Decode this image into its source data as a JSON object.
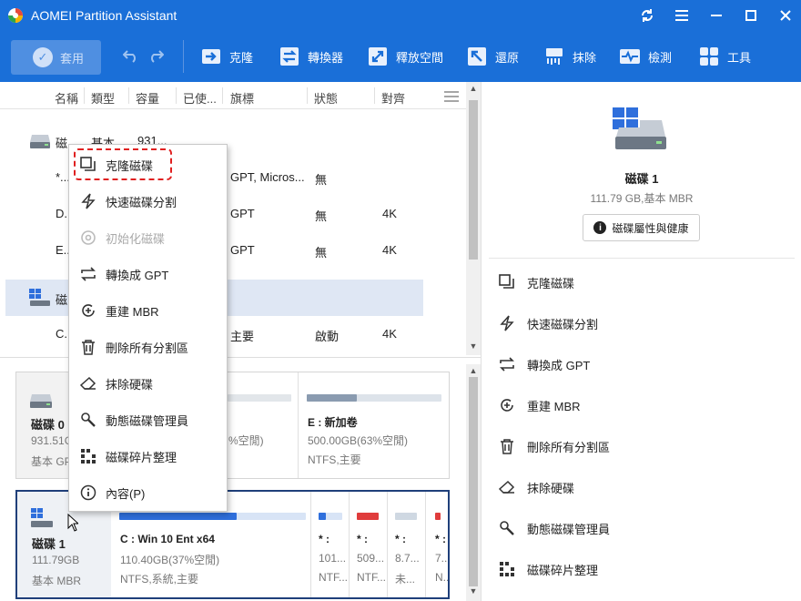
{
  "app": {
    "title": "AOMEI Partition Assistant"
  },
  "toolbar": {
    "apply_label": "套用",
    "buttons": [
      {
        "label": "克隆",
        "icon": "clone-icon"
      },
      {
        "label": "轉換器",
        "icon": "converter-icon"
      },
      {
        "label": "釋放空間",
        "icon": "free-space-icon"
      },
      {
        "label": "還原",
        "icon": "restore-icon"
      },
      {
        "label": "抹除",
        "icon": "wipe-icon"
      },
      {
        "label": "檢測",
        "icon": "check-icon"
      },
      {
        "label": "工具",
        "icon": "tools-icon"
      }
    ]
  },
  "table": {
    "columns": [
      "名稱",
      "類型",
      "容量",
      "已使...",
      "旗標",
      "狀態",
      "對齊"
    ],
    "rows": [
      {
        "name": "磁...",
        "type": "基本 ...",
        "cap": "931...",
        "used": "",
        "flag": "",
        "status": "",
        "align": ""
      },
      {
        "name": "*...",
        "type": "",
        "cap": "",
        "used": "",
        "flag": "GPT, Micros...",
        "status": "無",
        "align": ""
      },
      {
        "name": "D...",
        "type": "",
        "cap": "",
        "used": "",
        "flag": "GPT",
        "status": "無",
        "align": "4K"
      },
      {
        "name": "E...",
        "type": "",
        "cap": "",
        "used": "",
        "flag": "GPT",
        "status": "無",
        "align": "4K"
      },
      {
        "name": "磁...",
        "type": "",
        "cap": "",
        "used": "",
        "flag": "",
        "status": "",
        "align": ""
      },
      {
        "name": "C...",
        "type": "",
        "cap": "",
        "used": "",
        "flag": "主要",
        "status": "啟動",
        "align": "4K"
      }
    ]
  },
  "disk0": {
    "name": "磁碟 0",
    "size": "931.51G",
    "type": "基本 GP",
    "partitions": [
      {
        "name": "",
        "detail": "%空閒)",
        "fs": ""
      },
      {
        "name": "E : 新加卷",
        "detail": "500.00GB(63%空閒)",
        "fs": "NTFS,主要",
        "fill": 0.37
      }
    ]
  },
  "disk1": {
    "name": "磁碟 1",
    "size": "111.79GB",
    "type": "基本 MBR",
    "partitions": [
      {
        "name": "C : Win 10 Ent x64",
        "detail": "110.40GB(37%空閒)",
        "fs": "NTFS,系統,主要",
        "fill": 0.63,
        "color": "#2f6fdc"
      },
      {
        "name": "* :",
        "detail": "101...",
        "fs": "NTF...",
        "color": "#2f6fdc"
      },
      {
        "name": "* :",
        "detail": "509...",
        "fs": "NTF...",
        "color": "#e03c3c"
      },
      {
        "name": "* :",
        "detail": "8.7...",
        "fs": "未...",
        "color": "#cfd8e2"
      },
      {
        "name": "* :",
        "detail": "7...",
        "fs": "N...",
        "color": "#e03c3c"
      }
    ]
  },
  "right": {
    "disk_name": "磁碟 1",
    "disk_detail": "111.79 GB,基本 MBR",
    "props_button": "磁碟屬性與健康",
    "items": [
      {
        "label": "克隆磁碟",
        "icon": "clone-disk-icon"
      },
      {
        "label": "快速磁碟分割",
        "icon": "quick-partition-icon"
      },
      {
        "label": "轉換成 GPT",
        "icon": "convert-icon"
      },
      {
        "label": "重建 MBR",
        "icon": "rebuild-mbr-icon"
      },
      {
        "label": "刪除所有分割區",
        "icon": "trash-icon"
      },
      {
        "label": "抹除硬碟",
        "icon": "eraser-icon"
      },
      {
        "label": "動態磁碟管理員",
        "icon": "dynamic-disk-icon"
      },
      {
        "label": "磁碟碎片整理",
        "icon": "defrag-icon"
      }
    ]
  },
  "context_menu": {
    "items": [
      {
        "label": "克隆磁碟",
        "icon": "clone-disk-icon",
        "enabled": true
      },
      {
        "label": "快速磁碟分割",
        "icon": "quick-partition-icon",
        "enabled": true
      },
      {
        "label": "初始化磁碟",
        "icon": "initialize-icon",
        "enabled": false
      },
      {
        "label": "轉換成 GPT",
        "icon": "convert-icon",
        "enabled": true
      },
      {
        "label": "重建 MBR",
        "icon": "rebuild-mbr-icon",
        "enabled": true
      },
      {
        "label": "刪除所有分割區",
        "icon": "trash-icon",
        "enabled": true
      },
      {
        "label": "抹除硬碟",
        "icon": "eraser-icon",
        "enabled": true
      },
      {
        "label": "動態磁碟管理員",
        "icon": "dynamic-disk-icon",
        "enabled": true
      },
      {
        "label": "磁碟碎片整理",
        "icon": "defrag-icon",
        "enabled": true
      },
      {
        "label": "內容(P)",
        "icon": "info-icon",
        "enabled": true
      }
    ]
  },
  "colors": {
    "brand": "#1a6fd8",
    "selected_row": "#dfe7f4",
    "highlight": "#e02020"
  }
}
